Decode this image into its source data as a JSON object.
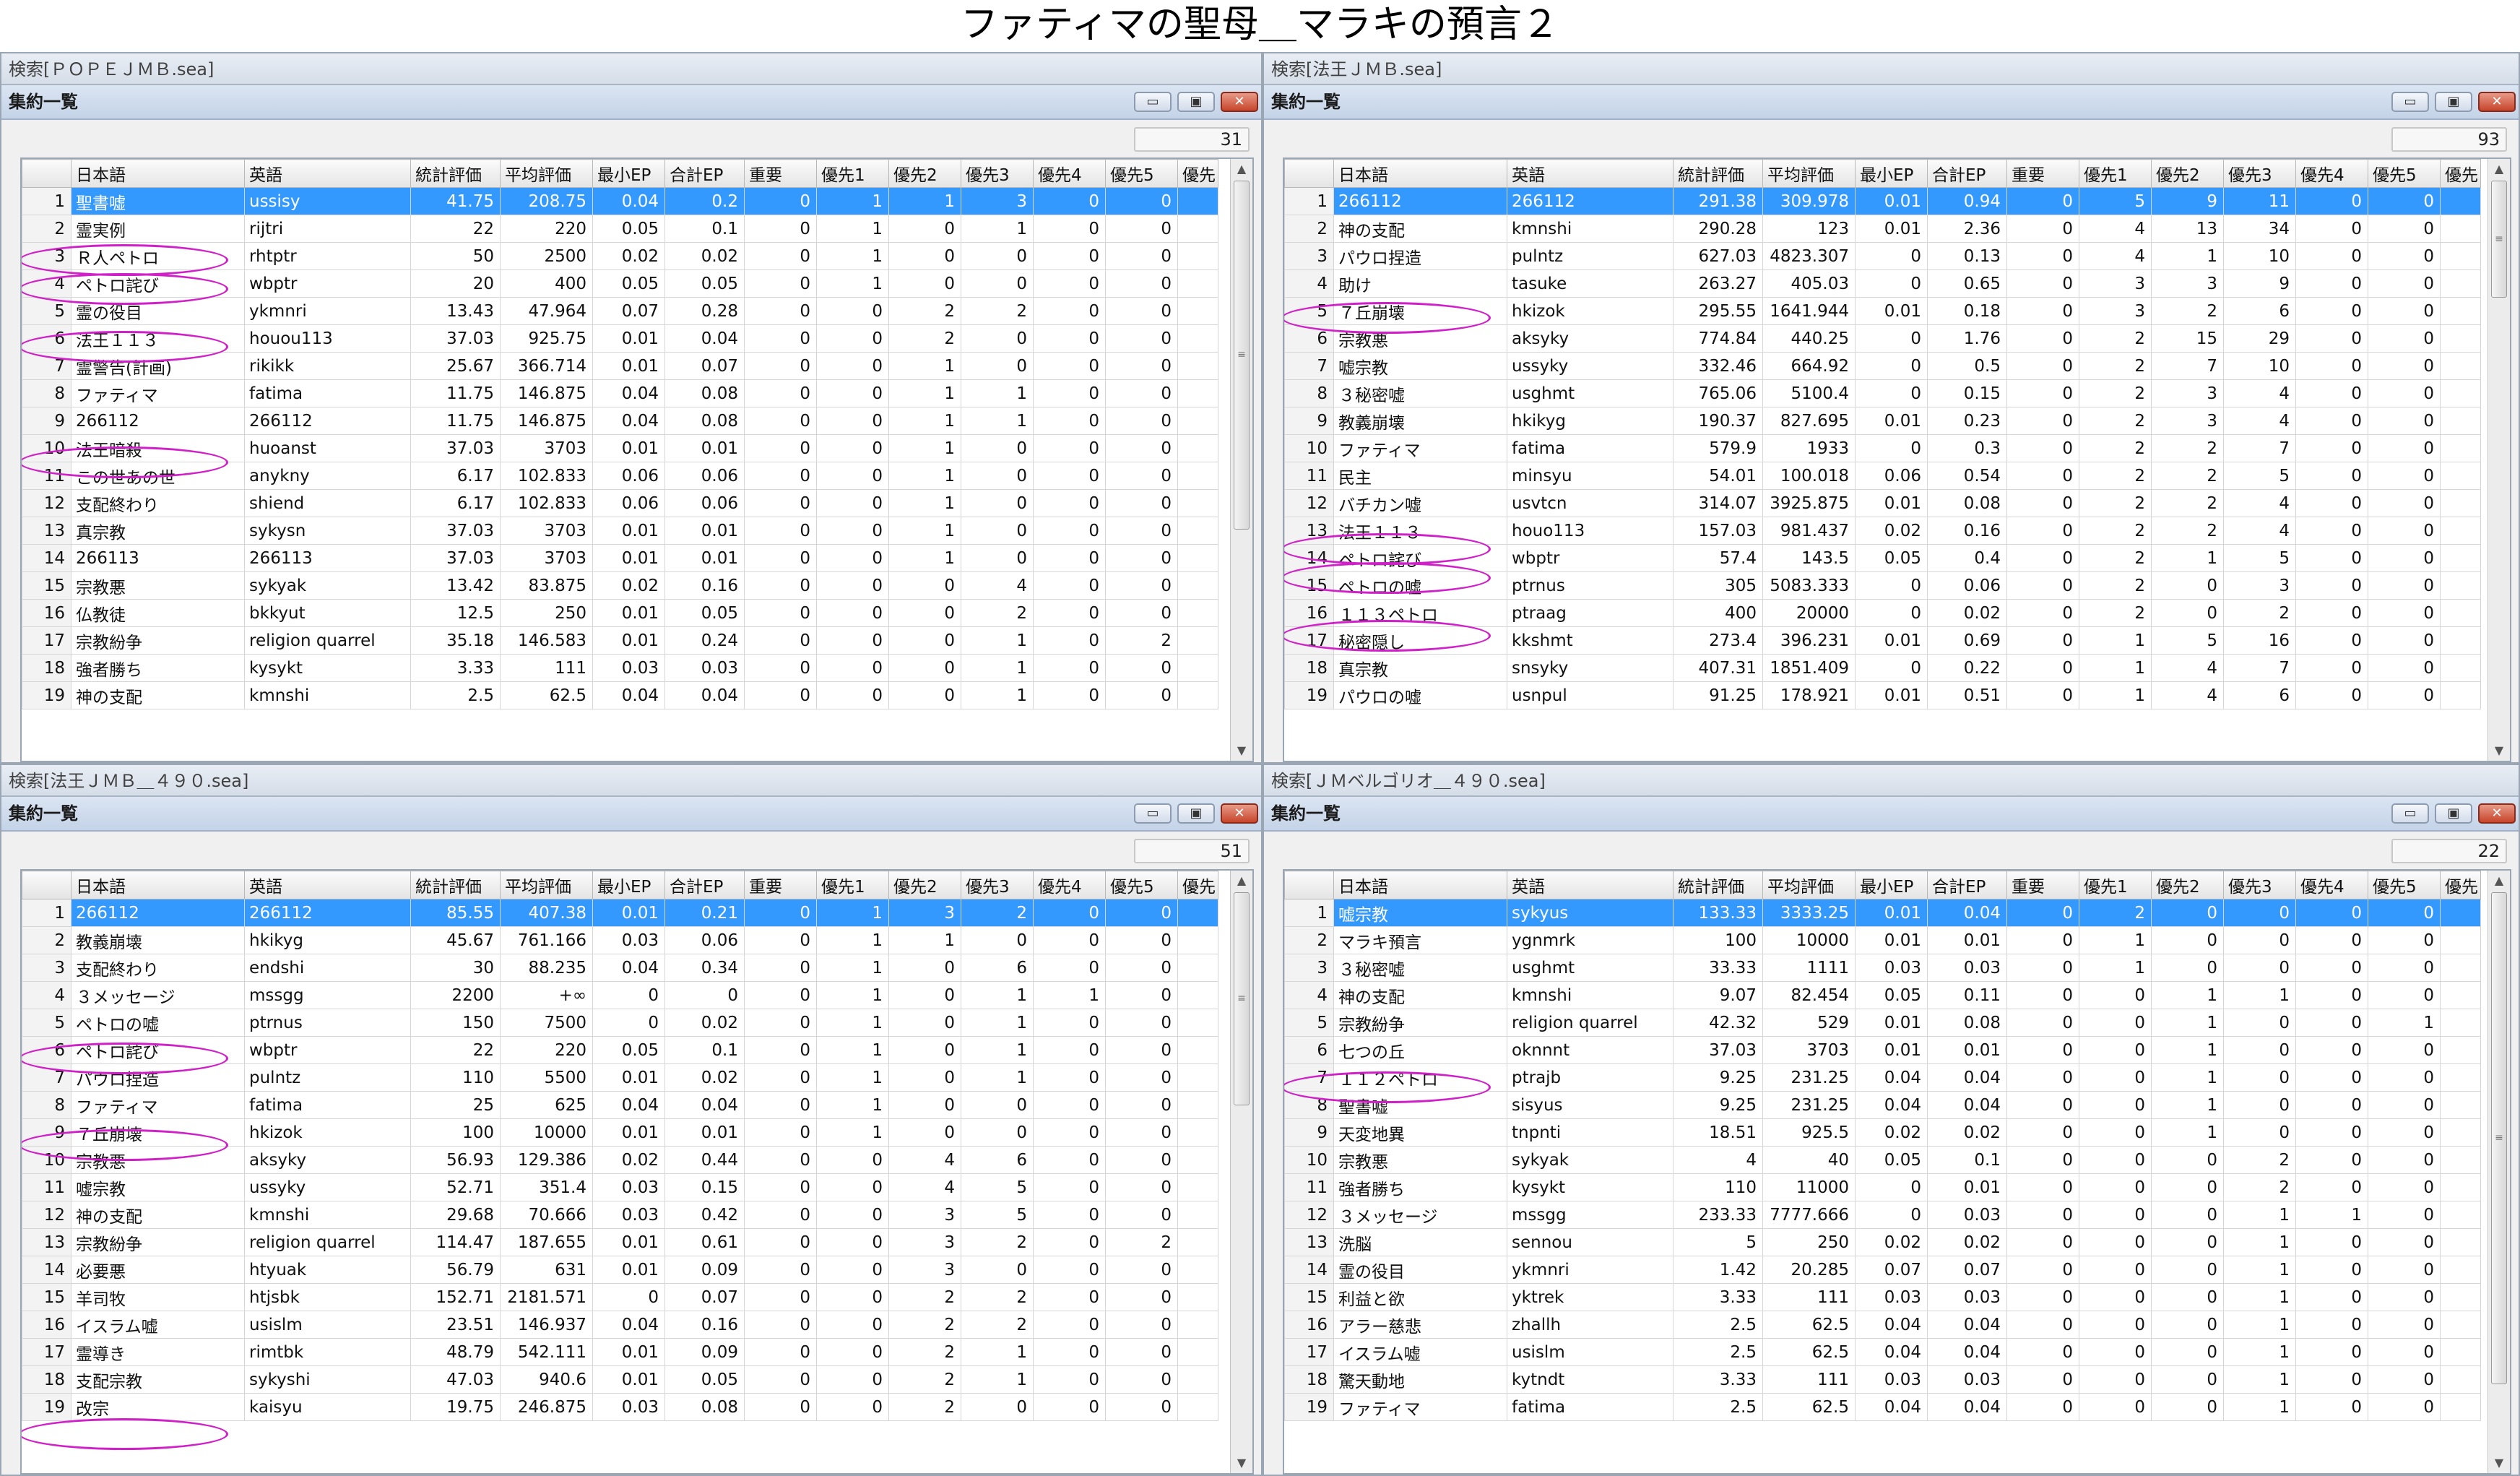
{
  "page_title": "ファティマの聖母＿マラキの預言２",
  "window_title": "集約一覧",
  "window_buttons": {
    "minimize": "▭",
    "maximize": "▣",
    "close": "✕"
  },
  "columns": [
    "日本語",
    "英語",
    "統計評価",
    "平均評価",
    "最小EP",
    "合計EP",
    "重要",
    "優先1",
    "優先2",
    "優先3",
    "優先4",
    "優先5",
    "優先"
  ],
  "panels": [
    {
      "search_label": "検索[ＰＯＰＥＪＭＢ.sea]",
      "count": "31",
      "rows": [
        [
          "1",
          "聖書嘘",
          "ussisy",
          "41.75",
          "208.75",
          "0.04",
          "0.2",
          "0",
          "1",
          "1",
          "3",
          "0",
          "0"
        ],
        [
          "2",
          "霊実例",
          "rijtri",
          "22",
          "220",
          "0.05",
          "0.1",
          "0",
          "1",
          "0",
          "1",
          "0",
          "0"
        ],
        [
          "3",
          "Ｒ人ペトロ",
          "rhtptr",
          "50",
          "2500",
          "0.02",
          "0.02",
          "0",
          "1",
          "0",
          "0",
          "0",
          "0"
        ],
        [
          "4",
          "ペトロ詫び",
          "wbptr",
          "20",
          "400",
          "0.05",
          "0.05",
          "0",
          "1",
          "0",
          "0",
          "0",
          "0"
        ],
        [
          "5",
          "霊の役目",
          "ykmnri",
          "13.43",
          "47.964",
          "0.07",
          "0.28",
          "0",
          "0",
          "2",
          "2",
          "0",
          "0"
        ],
        [
          "6",
          "法王１１３",
          "houou113",
          "37.03",
          "925.75",
          "0.01",
          "0.04",
          "0",
          "0",
          "2",
          "0",
          "0",
          "0"
        ],
        [
          "7",
          "霊警告(計画)",
          "rikikk",
          "25.67",
          "366.714",
          "0.01",
          "0.07",
          "0",
          "0",
          "1",
          "0",
          "0",
          "0"
        ],
        [
          "8",
          "ファティマ",
          "fatima",
          "11.75",
          "146.875",
          "0.04",
          "0.08",
          "0",
          "0",
          "1",
          "1",
          "0",
          "0"
        ],
        [
          "9",
          "266112",
          "266112",
          "11.75",
          "146.875",
          "0.04",
          "0.08",
          "0",
          "0",
          "1",
          "1",
          "0",
          "0"
        ],
        [
          "10",
          "法王暗殺",
          "huoanst",
          "37.03",
          "3703",
          "0.01",
          "0.01",
          "0",
          "0",
          "1",
          "0",
          "0",
          "0"
        ],
        [
          "11",
          "この世あの世",
          "anykny",
          "6.17",
          "102.833",
          "0.06",
          "0.06",
          "0",
          "0",
          "1",
          "0",
          "0",
          "0"
        ],
        [
          "12",
          "支配終わり",
          "shiend",
          "6.17",
          "102.833",
          "0.06",
          "0.06",
          "0",
          "0",
          "1",
          "0",
          "0",
          "0"
        ],
        [
          "13",
          "真宗教",
          "sykysn",
          "37.03",
          "3703",
          "0.01",
          "0.01",
          "0",
          "0",
          "1",
          "0",
          "0",
          "0"
        ],
        [
          "14",
          "266113",
          "266113",
          "37.03",
          "3703",
          "0.01",
          "0.01",
          "0",
          "0",
          "1",
          "0",
          "0",
          "0"
        ],
        [
          "15",
          "宗教悪",
          "sykyak",
          "13.42",
          "83.875",
          "0.02",
          "0.16",
          "0",
          "0",
          "0",
          "4",
          "0",
          "0"
        ],
        [
          "16",
          "仏教徒",
          "bkkyut",
          "12.5",
          "250",
          "0.01",
          "0.05",
          "0",
          "0",
          "0",
          "2",
          "0",
          "0"
        ],
        [
          "17",
          "宗教紛争",
          "religion quarrel",
          "35.18",
          "146.583",
          "0.01",
          "0.24",
          "0",
          "0",
          "0",
          "1",
          "0",
          "2"
        ],
        [
          "18",
          "強者勝ち",
          "kysykt",
          "3.33",
          "111",
          "0.03",
          "0.03",
          "0",
          "0",
          "0",
          "1",
          "0",
          "0"
        ],
        [
          "19",
          "神の支配",
          "kmnshi",
          "2.5",
          "62.5",
          "0.04",
          "0.04",
          "0",
          "0",
          "0",
          "1",
          "0",
          "0"
        ]
      ]
    },
    {
      "search_label": "検索[法王ＪＭＢ.sea]",
      "count": "93",
      "rows": [
        [
          "1",
          "266112",
          "266112",
          "291.38",
          "309.978",
          "0.01",
          "0.94",
          "0",
          "5",
          "9",
          "11",
          "0",
          "0"
        ],
        [
          "2",
          "神の支配",
          "kmnshi",
          "290.28",
          "123",
          "0.01",
          "2.36",
          "0",
          "4",
          "13",
          "34",
          "0",
          "0"
        ],
        [
          "3",
          "パウロ捏造",
          "pulntz",
          "627.03",
          "4823.307",
          "0",
          "0.13",
          "0",
          "4",
          "1",
          "10",
          "0",
          "0"
        ],
        [
          "4",
          "助け",
          "tasuke",
          "263.27",
          "405.03",
          "0",
          "0.65",
          "0",
          "3",
          "3",
          "9",
          "0",
          "0"
        ],
        [
          "5",
          "７丘崩壊",
          "hkizok",
          "295.55",
          "1641.944",
          "0.01",
          "0.18",
          "0",
          "3",
          "2",
          "6",
          "0",
          "0"
        ],
        [
          "6",
          "宗教悪",
          "aksyky",
          "774.84",
          "440.25",
          "0",
          "1.76",
          "0",
          "2",
          "15",
          "29",
          "0",
          "0"
        ],
        [
          "7",
          "嘘宗教",
          "ussyky",
          "332.46",
          "664.92",
          "0",
          "0.5",
          "0",
          "2",
          "7",
          "10",
          "0",
          "0"
        ],
        [
          "8",
          "３秘密嘘",
          "usghmt",
          "765.06",
          "5100.4",
          "0",
          "0.15",
          "0",
          "2",
          "3",
          "4",
          "0",
          "0"
        ],
        [
          "9",
          "教義崩壊",
          "hkikyg",
          "190.37",
          "827.695",
          "0.01",
          "0.23",
          "0",
          "2",
          "3",
          "4",
          "0",
          "0"
        ],
        [
          "10",
          "ファティマ",
          "fatima",
          "579.9",
          "1933",
          "0",
          "0.3",
          "0",
          "2",
          "2",
          "7",
          "0",
          "0"
        ],
        [
          "11",
          "民主",
          "minsyu",
          "54.01",
          "100.018",
          "0.06",
          "0.54",
          "0",
          "2",
          "2",
          "5",
          "0",
          "0"
        ],
        [
          "12",
          "バチカン嘘",
          "usvtcn",
          "314.07",
          "3925.875",
          "0.01",
          "0.08",
          "0",
          "2",
          "2",
          "4",
          "0",
          "0"
        ],
        [
          "13",
          "法王１１３",
          "houo113",
          "157.03",
          "981.437",
          "0.02",
          "0.16",
          "0",
          "2",
          "2",
          "4",
          "0",
          "0"
        ],
        [
          "14",
          "ペトロ詫び",
          "wbptr",
          "57.4",
          "143.5",
          "0.05",
          "0.4",
          "0",
          "2",
          "1",
          "5",
          "0",
          "0"
        ],
        [
          "15",
          "ペトロの嘘",
          "ptrnus",
          "305",
          "5083.333",
          "0",
          "0.06",
          "0",
          "2",
          "0",
          "3",
          "0",
          "0"
        ],
        [
          "16",
          "１１３ペトロ",
          "ptraag",
          "400",
          "20000",
          "0",
          "0.02",
          "0",
          "2",
          "0",
          "2",
          "0",
          "0"
        ],
        [
          "17",
          "秘密隠し",
          "kkshmt",
          "273.4",
          "396.231",
          "0.01",
          "0.69",
          "0",
          "1",
          "5",
          "16",
          "0",
          "0"
        ],
        [
          "18",
          "真宗教",
          "snsyky",
          "407.31",
          "1851.409",
          "0",
          "0.22",
          "0",
          "1",
          "4",
          "7",
          "0",
          "0"
        ],
        [
          "19",
          "パウロの嘘",
          "usnpul",
          "91.25",
          "178.921",
          "0.01",
          "0.51",
          "0",
          "1",
          "4",
          "6",
          "0",
          "0"
        ]
      ]
    },
    {
      "search_label": "検索[法王ＪＭＢ＿４９０.sea]",
      "count": "51",
      "rows": [
        [
          "1",
          "266112",
          "266112",
          "85.55",
          "407.38",
          "0.01",
          "0.21",
          "0",
          "1",
          "3",
          "2",
          "0",
          "0"
        ],
        [
          "2",
          "教義崩壊",
          "hkikyg",
          "45.67",
          "761.166",
          "0.03",
          "0.06",
          "0",
          "1",
          "1",
          "0",
          "0",
          "0"
        ],
        [
          "3",
          "支配終わり",
          "endshi",
          "30",
          "88.235",
          "0.04",
          "0.34",
          "0",
          "1",
          "0",
          "6",
          "0",
          "0"
        ],
        [
          "4",
          "３メッセージ",
          "mssgg",
          "2200",
          "+∞",
          "0",
          "0",
          "0",
          "1",
          "0",
          "1",
          "1",
          "0"
        ],
        [
          "5",
          "ペトロの嘘",
          "ptrnus",
          "150",
          "7500",
          "0",
          "0.02",
          "0",
          "1",
          "0",
          "1",
          "0",
          "0"
        ],
        [
          "6",
          "ペトロ詫び",
          "wbptr",
          "22",
          "220",
          "0.05",
          "0.1",
          "0",
          "1",
          "0",
          "1",
          "0",
          "0"
        ],
        [
          "7",
          "パウロ捏造",
          "pulntz",
          "110",
          "5500",
          "0.01",
          "0.02",
          "0",
          "1",
          "0",
          "1",
          "0",
          "0"
        ],
        [
          "8",
          "ファティマ",
          "fatima",
          "25",
          "625",
          "0.04",
          "0.04",
          "0",
          "1",
          "0",
          "0",
          "0",
          "0"
        ],
        [
          "9",
          "７丘崩壊",
          "hkizok",
          "100",
          "10000",
          "0.01",
          "0.01",
          "0",
          "1",
          "0",
          "0",
          "0",
          "0"
        ],
        [
          "10",
          "宗教悪",
          "aksyky",
          "56.93",
          "129.386",
          "0.02",
          "0.44",
          "0",
          "0",
          "4",
          "6",
          "0",
          "0"
        ],
        [
          "11",
          "嘘宗教",
          "ussyky",
          "52.71",
          "351.4",
          "0.03",
          "0.15",
          "0",
          "0",
          "4",
          "5",
          "0",
          "0"
        ],
        [
          "12",
          "神の支配",
          "kmnshi",
          "29.68",
          "70.666",
          "0.03",
          "0.42",
          "0",
          "0",
          "3",
          "5",
          "0",
          "0"
        ],
        [
          "13",
          "宗教紛争",
          "religion quarrel",
          "114.47",
          "187.655",
          "0.01",
          "0.61",
          "0",
          "0",
          "3",
          "2",
          "0",
          "2"
        ],
        [
          "14",
          "必要悪",
          "htyuak",
          "56.79",
          "631",
          "0.01",
          "0.09",
          "0",
          "0",
          "3",
          "0",
          "0",
          "0"
        ],
        [
          "15",
          "羊司牧",
          "htjsbk",
          "152.71",
          "2181.571",
          "0",
          "0.07",
          "0",
          "0",
          "2",
          "2",
          "0",
          "0"
        ],
        [
          "16",
          "イスラム嘘",
          "usislm",
          "23.51",
          "146.937",
          "0.04",
          "0.16",
          "0",
          "0",
          "2",
          "2",
          "0",
          "0"
        ],
        [
          "17",
          "霊導き",
          "rimtbk",
          "48.79",
          "542.111",
          "0.01",
          "0.09",
          "0",
          "0",
          "2",
          "1",
          "0",
          "0"
        ],
        [
          "18",
          "支配宗教",
          "sykyshi",
          "47.03",
          "940.6",
          "0.01",
          "0.05",
          "0",
          "0",
          "2",
          "1",
          "0",
          "0"
        ],
        [
          "19",
          "改宗",
          "kaisyu",
          "19.75",
          "246.875",
          "0.03",
          "0.08",
          "0",
          "0",
          "2",
          "0",
          "0",
          "0"
        ]
      ]
    },
    {
      "search_label": "検索[ＪＭベルゴリオ＿４９０.sea]",
      "count": "22",
      "rows": [
        [
          "1",
          "嘘宗教",
          "sykyus",
          "133.33",
          "3333.25",
          "0.01",
          "0.04",
          "0",
          "2",
          "0",
          "0",
          "0",
          "0"
        ],
        [
          "2",
          "マラキ預言",
          "ygnmrk",
          "100",
          "10000",
          "0.01",
          "0.01",
          "0",
          "1",
          "0",
          "0",
          "0",
          "0"
        ],
        [
          "3",
          "３秘密嘘",
          "usghmt",
          "33.33",
          "1111",
          "0.03",
          "0.03",
          "0",
          "1",
          "0",
          "0",
          "0",
          "0"
        ],
        [
          "4",
          "神の支配",
          "kmnshi",
          "9.07",
          "82.454",
          "0.05",
          "0.11",
          "0",
          "0",
          "1",
          "1",
          "0",
          "0"
        ],
        [
          "5",
          "宗教紛争",
          "religion quarrel",
          "42.32",
          "529",
          "0.01",
          "0.08",
          "0",
          "0",
          "1",
          "0",
          "0",
          "1"
        ],
        [
          "6",
          "七つの丘",
          "oknnnt",
          "37.03",
          "3703",
          "0.01",
          "0.01",
          "0",
          "0",
          "1",
          "0",
          "0",
          "0"
        ],
        [
          "7",
          "１１２ペトロ",
          "ptrajb",
          "9.25",
          "231.25",
          "0.04",
          "0.04",
          "0",
          "0",
          "1",
          "0",
          "0",
          "0"
        ],
        [
          "8",
          "聖書嘘",
          "sisyus",
          "9.25",
          "231.25",
          "0.04",
          "0.04",
          "0",
          "0",
          "1",
          "0",
          "0",
          "0"
        ],
        [
          "9",
          "天変地異",
          "tnpnti",
          "18.51",
          "925.5",
          "0.02",
          "0.02",
          "0",
          "0",
          "1",
          "0",
          "0",
          "0"
        ],
        [
          "10",
          "宗教悪",
          "sykyak",
          "4",
          "40",
          "0.05",
          "0.1",
          "0",
          "0",
          "0",
          "2",
          "0",
          "0"
        ],
        [
          "11",
          "強者勝ち",
          "kysykt",
          "110",
          "11000",
          "0",
          "0.01",
          "0",
          "0",
          "0",
          "2",
          "0",
          "0"
        ],
        [
          "12",
          "３メッセージ",
          "mssgg",
          "233.33",
          "7777.666",
          "0",
          "0.03",
          "0",
          "0",
          "0",
          "1",
          "1",
          "0"
        ],
        [
          "13",
          "洗脳",
          "sennou",
          "5",
          "250",
          "0.02",
          "0.02",
          "0",
          "0",
          "0",
          "1",
          "0",
          "0"
        ],
        [
          "14",
          "霊の役目",
          "ykmnri",
          "1.42",
          "20.285",
          "0.07",
          "0.07",
          "0",
          "0",
          "0",
          "1",
          "0",
          "0"
        ],
        [
          "15",
          "利益と欲",
          "yktrek",
          "3.33",
          "111",
          "0.03",
          "0.03",
          "0",
          "0",
          "0",
          "1",
          "0",
          "0"
        ],
        [
          "16",
          "アラー慈悲",
          "zhallh",
          "2.5",
          "62.5",
          "0.04",
          "0.04",
          "0",
          "0",
          "0",
          "1",
          "0",
          "0"
        ],
        [
          "17",
          "イスラム嘘",
          "usislm",
          "2.5",
          "62.5",
          "0.04",
          "0.04",
          "0",
          "0",
          "0",
          "1",
          "0",
          "0"
        ],
        [
          "18",
          "驚天動地",
          "kytndt",
          "3.33",
          "111",
          "0.03",
          "0.03",
          "0",
          "0",
          "0",
          "1",
          "0",
          "0"
        ],
        [
          "19",
          "ファティマ",
          "fatima",
          "2.5",
          "62.5",
          "0.04",
          "0.04",
          "0",
          "0",
          "0",
          "1",
          "0",
          "0"
        ]
      ]
    }
  ],
  "highlighted_rows": [
    [
      3,
      4,
      6,
      10
    ],
    [
      5,
      13,
      14,
      16
    ],
    [
      6,
      9,
      19
    ],
    [
      7
    ]
  ],
  "colors": {
    "selection": "#3399ff",
    "highlight_ring": "#d020c8",
    "titlebar": "#c4d3e7"
  },
  "icons": {
    "scroll_up": "▲",
    "scroll_down": "▼",
    "thumb_grip": "≡"
  }
}
